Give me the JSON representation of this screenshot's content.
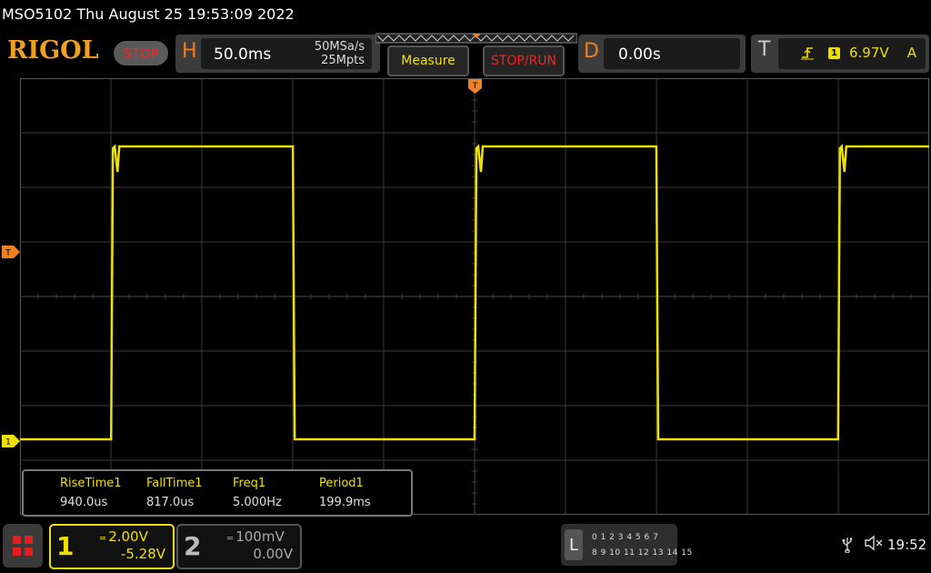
{
  "title_bar": "MSO5102  Thu August 25 19:53:09 2022",
  "brand": "RIGOL",
  "run_state": "STOP",
  "horizontal": {
    "letter": "H",
    "scale": "50.0ms",
    "sample_rate": "50MSa/s",
    "memory_depth": "25Mpts"
  },
  "menu": {
    "measure_label": "Measure",
    "stoprun_label": "STOP/RUN"
  },
  "delay": {
    "letter": "D",
    "value": "0.00s"
  },
  "trigger": {
    "letter": "T",
    "source": "1",
    "level": "6.97V",
    "mode": "A",
    "marker": "T",
    "edge_icon": "rising-edge-icon"
  },
  "channel_marker": "1",
  "waveform": {
    "color": "#f0e000",
    "type": "square",
    "frequency_hz": 5.0,
    "period_ms": 199.9,
    "time_per_div_ms": 50.0,
    "volts_per_div": 2.0,
    "offset_v": -5.28
  },
  "measurements": {
    "headers": [
      "RiseTime1",
      "FallTime1",
      "Freq1",
      "Period1"
    ],
    "values": [
      "940.0us",
      "817.0us",
      "5.000Hz",
      "199.9ms"
    ]
  },
  "ch1": {
    "num": "1",
    "scale": "2.00V",
    "offset": "-5.28V",
    "color": "#f0e000"
  },
  "ch2": {
    "num": "2",
    "scale": "100mV",
    "offset": "0.00V"
  },
  "la": {
    "letter": "L",
    "row1": "0 1 2 3  4 5 6 7",
    "row2": "8 9 10 11 12 13 14 15"
  },
  "status": {
    "clock": "19:52",
    "usb_icon": "usb-icon",
    "speaker_icon": "speaker-muted-icon"
  }
}
